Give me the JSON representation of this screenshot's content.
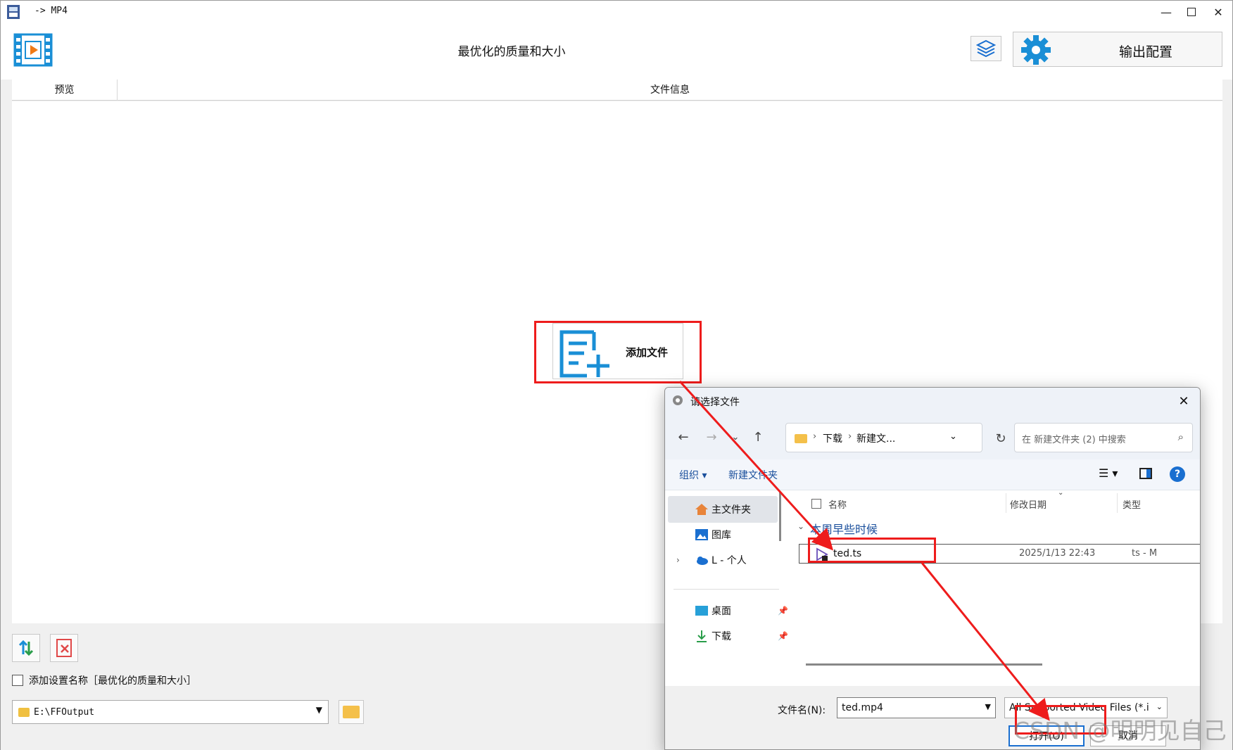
{
  "window": {
    "title": "-> MP4"
  },
  "header": {
    "preset": "最优化的质量和大小",
    "output_config": "输出配置"
  },
  "columns": {
    "preview": "预览",
    "file_info": "文件信息"
  },
  "main": {
    "add_file": "添加文件"
  },
  "bottom": {
    "add_setting_name": "添加设置名称［最优化的质量和大小］",
    "output_path": "E:\\FFOutput"
  },
  "dialog": {
    "title": "请选择文件",
    "breadcrumb": [
      "下载",
      "新建文..."
    ],
    "search_placeholder": "在 新建文件夹 (2) 中搜索",
    "commands": {
      "organize": "组织 ▾",
      "new_folder": "新建文件夹"
    },
    "nav": {
      "home": "主文件夹",
      "gallery": "图库",
      "onedrive": "L - 个人",
      "desktop": "桌面",
      "downloads": "下载"
    },
    "list_headers": {
      "name": "名称",
      "modified": "修改日期",
      "type": "类型"
    },
    "group": "本周早些时候",
    "files": [
      {
        "name": "ted.ts",
        "date": "2025/1/13 22:43",
        "type": "ts - M"
      }
    ],
    "filename_label": "文件名(N):",
    "filename_value": "ted.mp4",
    "filter": "All Supported Video Files (*.i",
    "open": "打开(O)",
    "cancel": "取消"
  },
  "watermark": "CSDN @明明见自己",
  "colors": {
    "accent": "#1a6fd0",
    "highlight": "#ee1c1c",
    "folder": "#f4c04a"
  }
}
